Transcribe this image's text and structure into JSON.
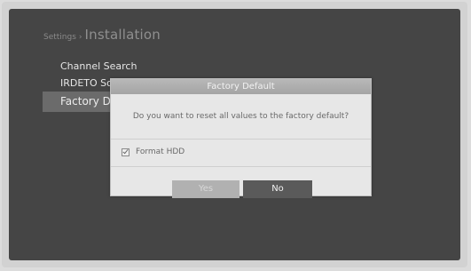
{
  "breadcrumb": {
    "parent": "Settings",
    "separator": "›",
    "title": "Installation"
  },
  "menu": {
    "items": [
      {
        "label": "Channel Search"
      },
      {
        "label": "IRDETO Software Update"
      },
      {
        "label": "Factory Default"
      }
    ],
    "selected_index": 2
  },
  "dialog": {
    "title": "Factory Default",
    "message": "Do you want to reset all values to the factory default?",
    "option_label": "Format HDD",
    "option_checked": true,
    "yes_label": "Yes",
    "no_label": "No"
  }
}
